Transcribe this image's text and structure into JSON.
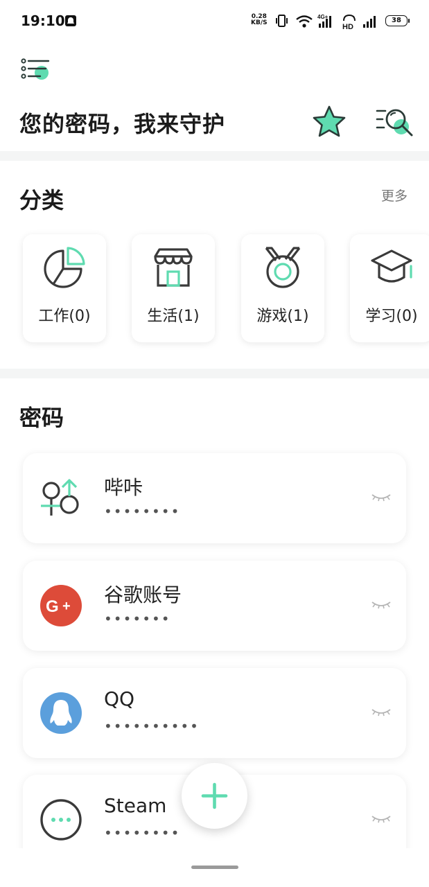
{
  "status_bar": {
    "time": "19:10",
    "speed_value": "0.28",
    "speed_unit": "KB/S",
    "network": "4G+",
    "hd": "HD",
    "battery": "38"
  },
  "header": {
    "title": "您的密码，我来守护",
    "icons": [
      "menu-icon",
      "star-icon",
      "search-icon"
    ],
    "accent_color": "#5fdbb0"
  },
  "categories": {
    "title": "分类",
    "more_label": "更多",
    "items": [
      {
        "label": "工作(0)",
        "icon": "pie-chart-icon"
      },
      {
        "label": "生活(1)",
        "icon": "store-icon"
      },
      {
        "label": "游戏(1)",
        "icon": "medal-icon"
      },
      {
        "label": "学习(0)",
        "icon": "graduation-cap-icon"
      }
    ]
  },
  "passwords": {
    "title": "密码",
    "items": [
      {
        "name": "哔咔",
        "masked": "••••••••",
        "icon": "gender-symbols-icon"
      },
      {
        "name": "谷歌账号",
        "masked": "•••••••",
        "icon": "google-plus-icon",
        "icon_color": "#dd4b39"
      },
      {
        "name": "QQ",
        "masked": "••••••••••",
        "icon": "qq-penguin-icon",
        "icon_color": "#5b9fdc"
      },
      {
        "name": "Steam",
        "masked": "••••••••",
        "icon": "more-dots-icon"
      }
    ]
  },
  "fab": {
    "icon": "plus-icon"
  }
}
